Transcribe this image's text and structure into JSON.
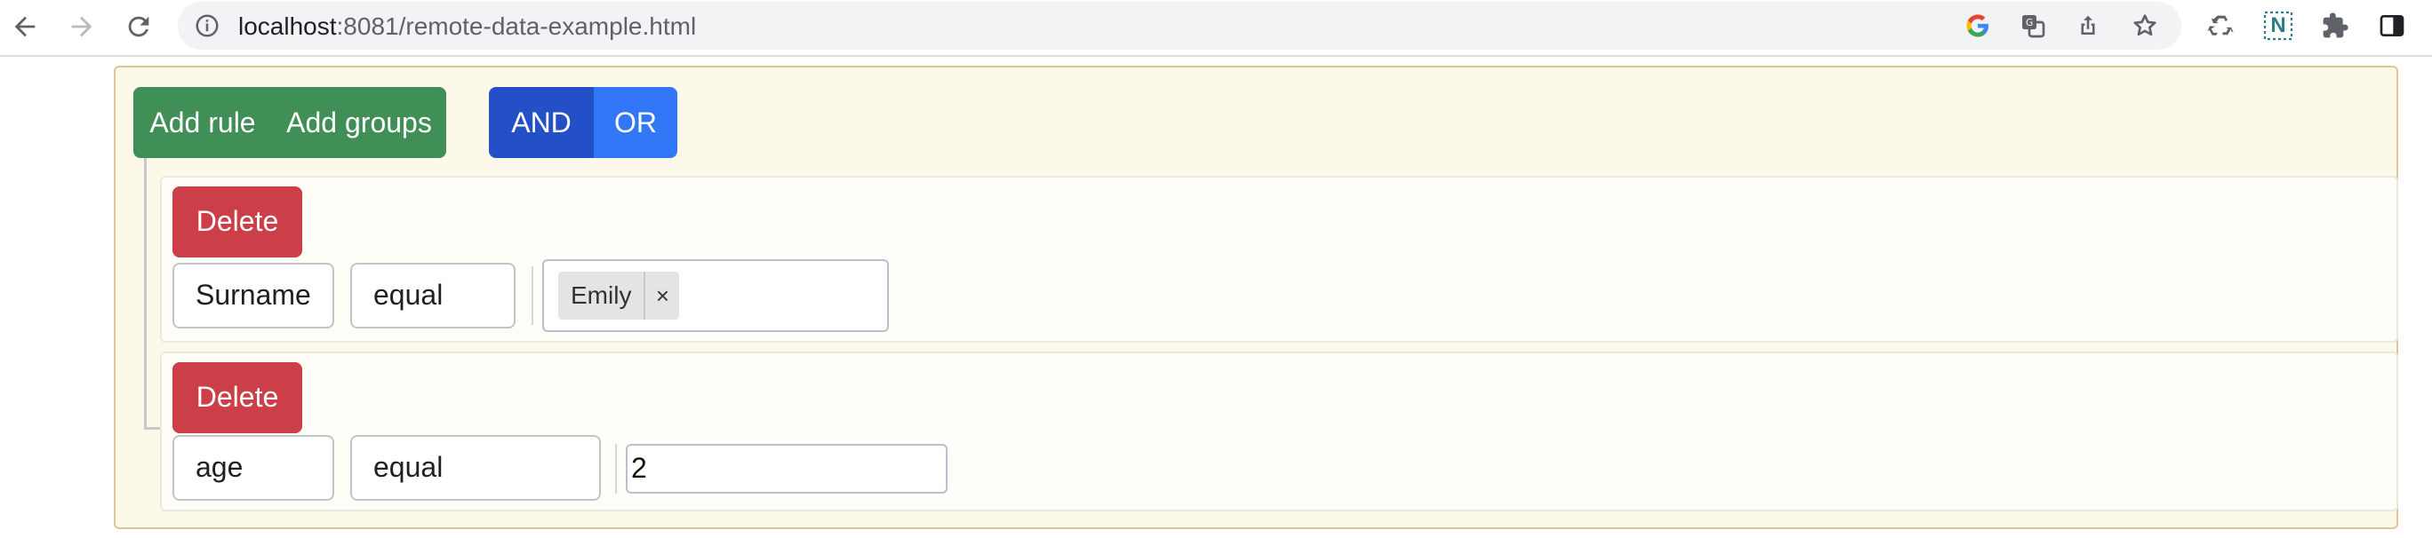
{
  "browser": {
    "url_host": "localhost",
    "url_rest": ":8081/remote-data-example.html",
    "icons": [
      "back-icon",
      "forward-icon",
      "reload-icon",
      "info-icon",
      "google-icon",
      "translate-icon",
      "share-icon",
      "bookmark-star-icon",
      "recycle-extension-icon",
      "n-extension-icon",
      "puzzle-extensions-icon",
      "sidepanel-icon"
    ],
    "n_extension_label": "N"
  },
  "query_builder": {
    "add_rule_label": "Add rule",
    "add_groups_label": "Add groups",
    "condition_and_label": "AND",
    "condition_or_label": "OR",
    "active_condition": "AND",
    "rules": [
      {
        "delete_label": "Delete",
        "field": "Surname",
        "operator": "equal",
        "value_tags": [
          {
            "label": "Emily",
            "remove": "×"
          }
        ]
      },
      {
        "delete_label": "Delete",
        "field": "age",
        "operator": "equal",
        "value": "2"
      }
    ]
  },
  "colors": {
    "add_buttons": "#3f8f57",
    "and_active": "#2350c7",
    "or_button": "#3277f7",
    "delete_button": "#cd3f48",
    "builder_background": "#fcf9ea",
    "builder_border": "#dcc896"
  }
}
